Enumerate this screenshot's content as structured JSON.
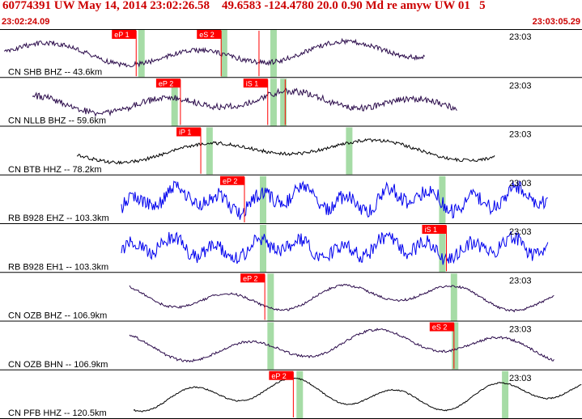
{
  "header": {
    "title": "60774391 UW May 14, 2014 23:02:26.58    49.6583 -124.4780 20.0 0.90 Md re amyw UW 01   5",
    "start_time": "23:02:24.09",
    "end_time": "23:03:05.29"
  },
  "colors": {
    "header_text": "#cc0000",
    "trace_purple": "#2a0a4a",
    "trace_black": "#000000",
    "trace_blue": "#0000ee",
    "pick_red": "#ff0000",
    "window_green": "#a6dca6"
  },
  "traces": [
    {
      "label": "CN SHB BHZ -- 43.6km",
      "time_label": "23:03",
      "color": "#2a0a4a",
      "picks": [
        {
          "label": "eP 1",
          "t": 0.234
        },
        {
          "label": "eS 2",
          "t": 0.38
        },
        {
          "label": "",
          "t": 0.445
        }
      ]
    },
    {
      "label": "CN NLLB BHZ -- 59.6km",
      "time_label": "23:03",
      "color": "#2a0a4a",
      "picks": [
        {
          "label": "eP 2",
          "t": 0.31
        },
        {
          "label": "iS 1",
          "t": 0.46
        },
        {
          "label": "",
          "t": 0.49
        }
      ]
    },
    {
      "label": "CN BTB HHZ -- 78.2km",
      "time_label": "23:03",
      "color": "#000000",
      "picks": [
        {
          "label": "iP 1",
          "t": 0.345
        }
      ]
    },
    {
      "label": "RB B928 EHZ -- 103.3km",
      "time_label": "23:03",
      "color": "#0000ee",
      "picks": [
        {
          "label": "eP 2",
          "t": 0.42
        }
      ]
    },
    {
      "label": "RB B928 EH1 -- 103.3km",
      "time_label": "23:03",
      "color": "#0000ee",
      "picks": [
        {
          "label": "iS 1",
          "t": 0.767
        }
      ]
    },
    {
      "label": "CN OZB BHZ -- 106.9km",
      "time_label": "23:03",
      "color": "#2a0a4a",
      "picks": [
        {
          "label": "eP 2",
          "t": 0.455
        }
      ]
    },
    {
      "label": "CN OZB BHN -- 106.9km",
      "time_label": "23:03",
      "color": "#2a0a4a",
      "picks": [
        {
          "label": "eS 2",
          "t": 0.78
        }
      ]
    },
    {
      "label": "CN PFB HHZ -- 120.5km",
      "time_label": "23:03",
      "color": "#000000",
      "picks": [
        {
          "label": "eP 2",
          "t": 0.504
        }
      ]
    }
  ]
}
